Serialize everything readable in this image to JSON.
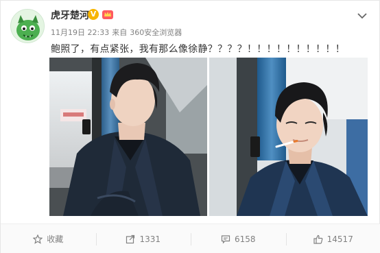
{
  "post": {
    "username": "虎牙楚河",
    "verified_mark": "V",
    "date": "11月19日 22:33",
    "source_prefix": "来自",
    "source": "360安全浏览器",
    "text": "鲍照了，有点紧张，我有那么像徐静？？？？！！！！！！！！！！"
  },
  "icons": {
    "avatar": "green-monster-avatar",
    "badge": "vip-crown-badge",
    "menu": "chevron-down-icon",
    "collect": "star-icon",
    "repost": "share-icon",
    "comment": "comment-icon",
    "like": "thumbs-up-icon"
  },
  "actions": {
    "collect_label": "收藏",
    "repost_count": "1331",
    "comment_count": "6158",
    "like_count": "14517"
  },
  "colors": {
    "accent": "#f7b500",
    "muted": "#808080"
  }
}
